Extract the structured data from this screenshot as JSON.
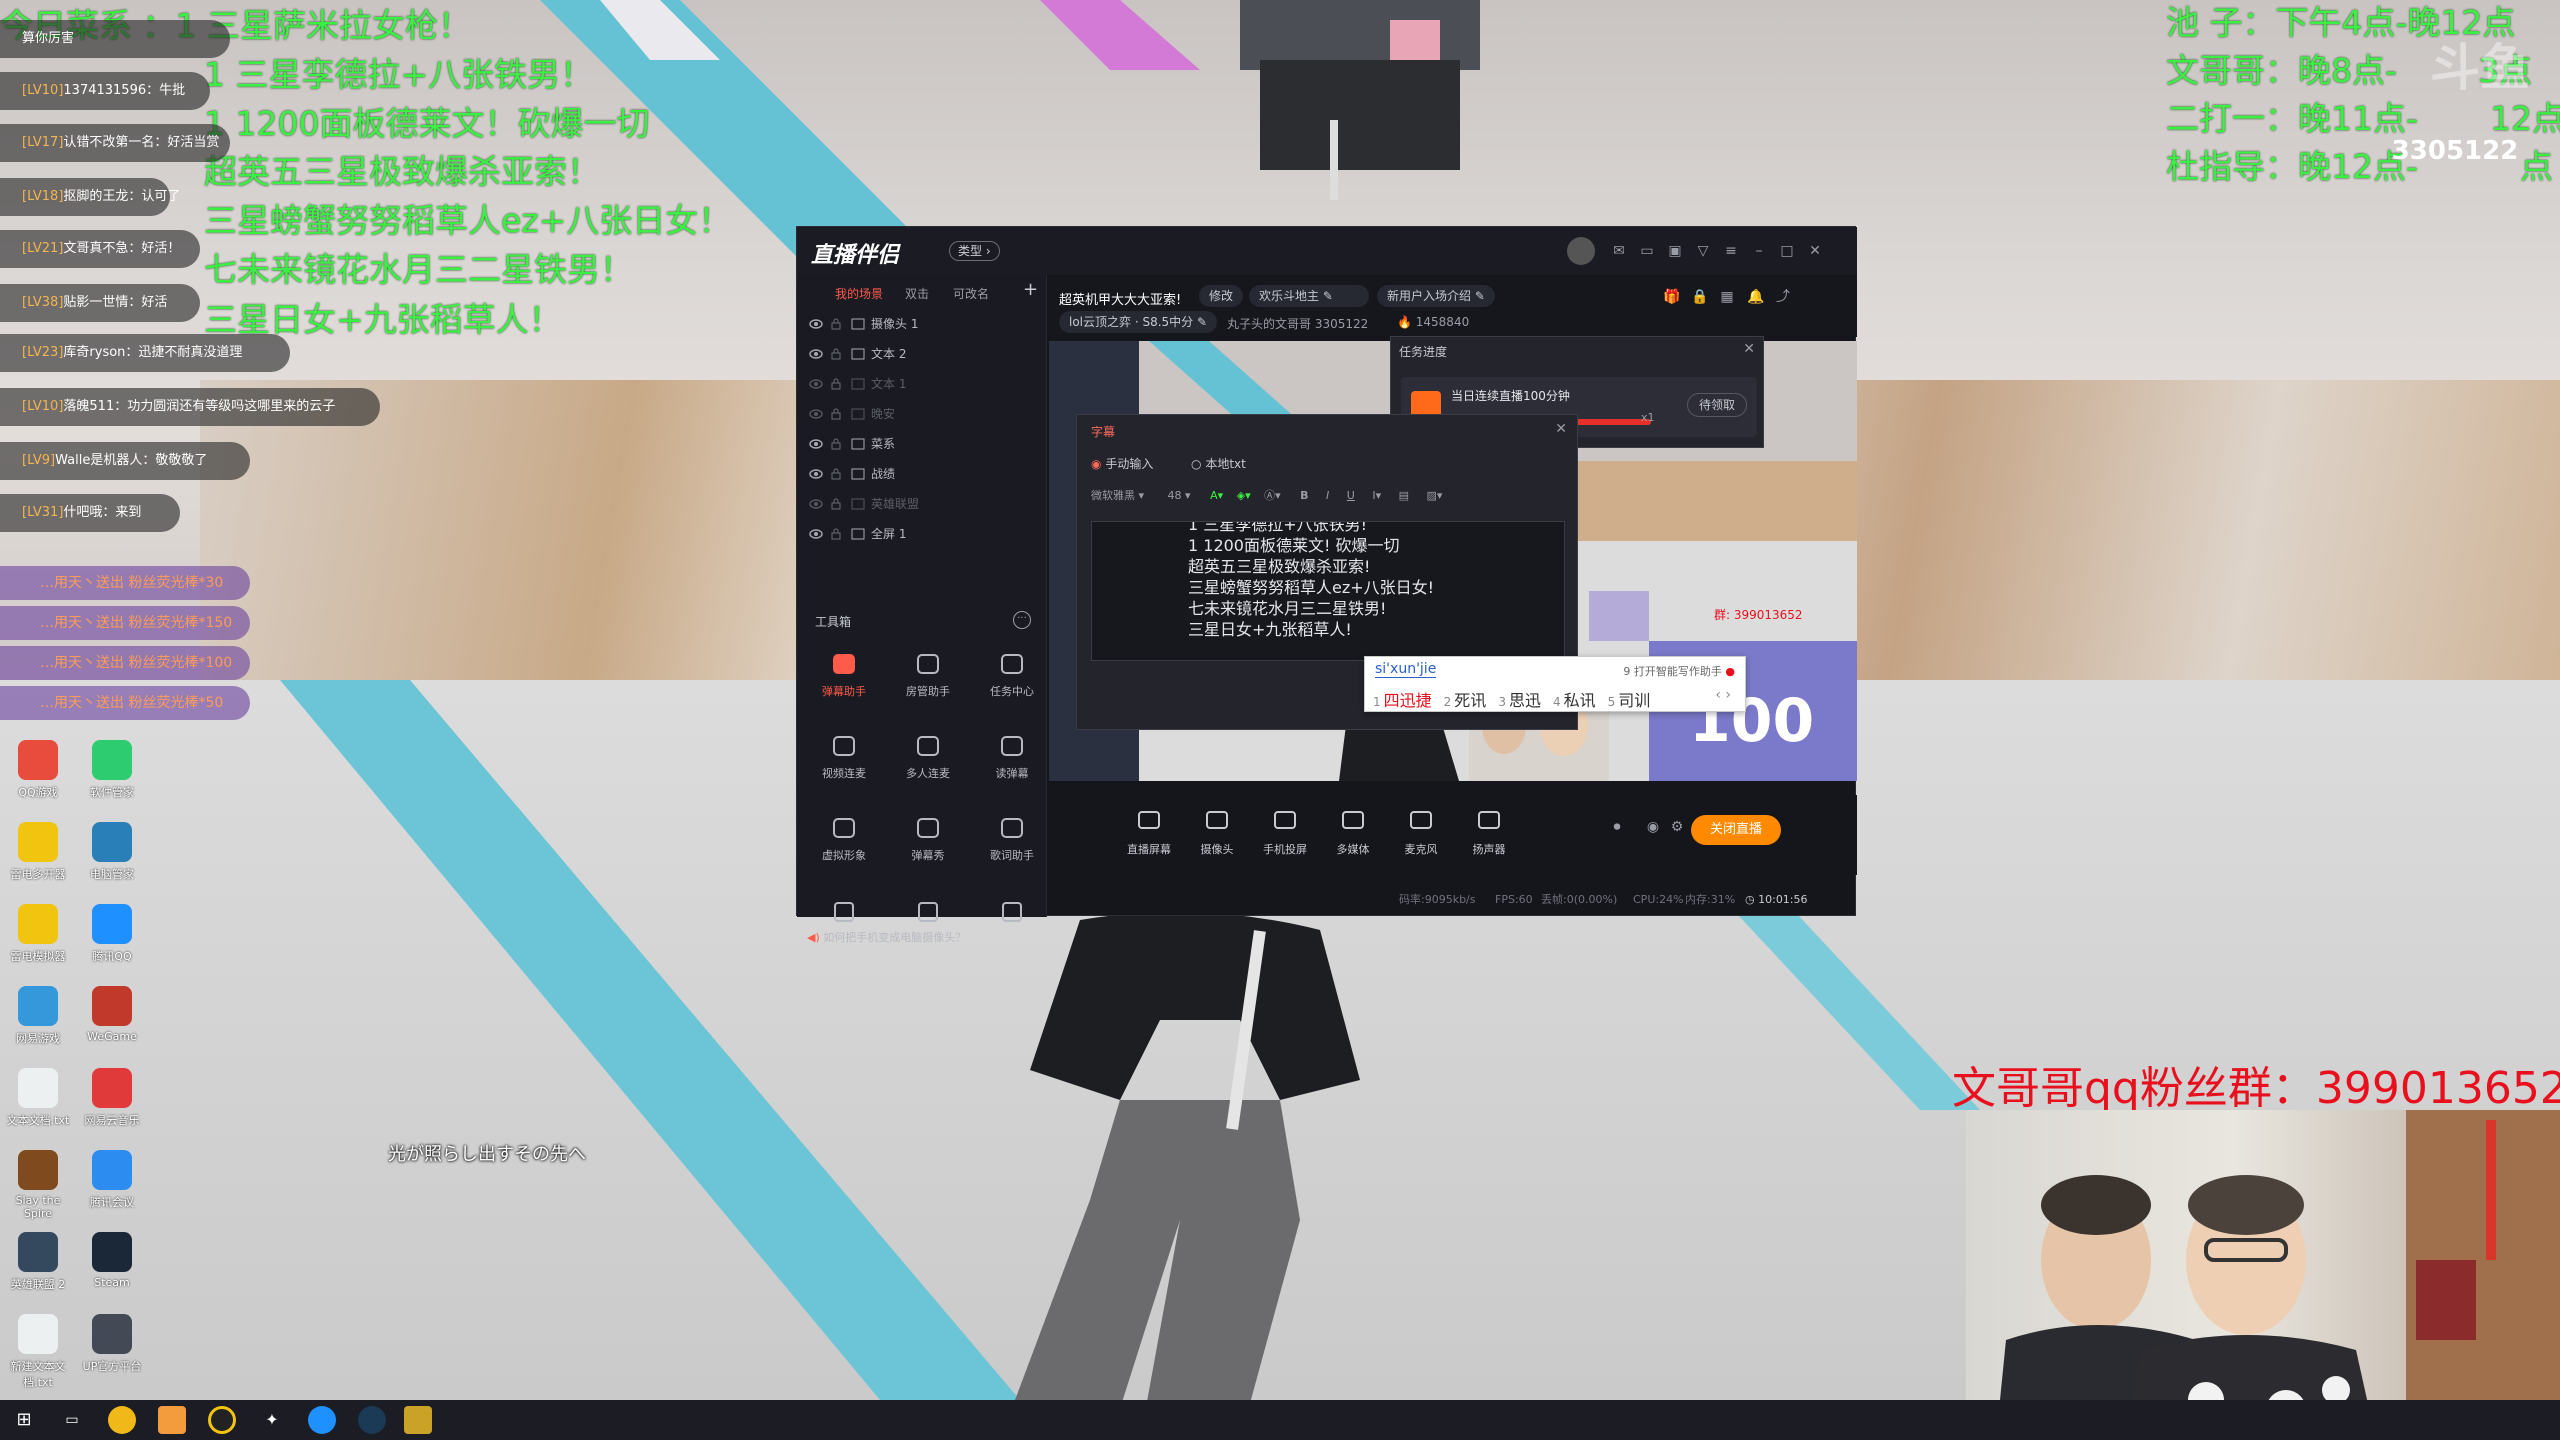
{
  "overlay_left": {
    "lines": [
      "今日菜系 ：1 三星萨米拉女枪！",
      "1 三星孪德拉+八张铁男！",
      "1 1200面板德莱文！砍爆一切",
      "超英五三星极致爆杀亚索！",
      "三星螃蟹努努稻草人ez+八张日女！",
      "七未来镜花水月三二星铁男！",
      "三星日女+九张稻草人！"
    ]
  },
  "overlay_right": {
    "lines": [
      "池 子：下午4点-晚12点",
      "文哥哥：晚8点-",
      "二打一：晚11点-",
      "杜指导：晚12点-"
    ],
    "tail_fragments": [
      "3点",
      "12点",
      "点"
    ]
  },
  "watermark": {
    "text": "3305122"
  },
  "qq_group": {
    "text": "文哥哥qq粉丝群：399013652"
  },
  "lyric": {
    "text": "光が照らし出すその先へ"
  },
  "chat": [
    {
      "level": "",
      "text": "算你厉害"
    },
    {
      "level": "[LV10]",
      "text": "1374131596：牛批"
    },
    {
      "level": "[LV17]",
      "text": "认错不改第一名：好活当赏"
    },
    {
      "level": "[LV18]",
      "text": "抠脚的王龙：认可了"
    },
    {
      "level": "[LV21]",
      "text": "文哥真不急：好活！"
    },
    {
      "level": "[LV38]",
      "text": "贴影一世情：好活"
    },
    {
      "level": "[LV23]",
      "text": "库奇ryson：迅捷不耐真没道理"
    },
    {
      "level": "[LV10]",
      "text": "落魄511：功力圆润还有等级吗这哪里来的云子"
    },
    {
      "level": "[LV9]",
      "text": "Walle是机器人：敬敬敬了"
    },
    {
      "level": "[LV31]",
      "text": "什吧哦：来到"
    }
  ],
  "gifts": [
    {
      "text": "…用天丶送出 粉丝荧光棒*30"
    },
    {
      "text": "…用天丶送出 粉丝荧光棒*150"
    },
    {
      "text": "…用天丶送出 粉丝荧光棒*100"
    },
    {
      "text": "…用天丶送出 粉丝荧光棒*50"
    }
  ],
  "desktop_icons": [
    {
      "label": "QQ游戏",
      "color": "#e74c3c"
    },
    {
      "label": "软件管家",
      "color": "#2ecc71"
    },
    {
      "label": "雷电多开器",
      "color": "#f1c40f"
    },
    {
      "label": "电脑管家",
      "color": "#2980b9"
    },
    {
      "label": "雷电模拟器",
      "color": "#f1c40f"
    },
    {
      "label": "腾讯QQ",
      "color": "#1e90ff"
    },
    {
      "label": "网易游戏",
      "color": "#3498db"
    },
    {
      "label": "WeGame",
      "color": "#c0392b"
    },
    {
      "label": "文本文档.txt",
      "color": "#ecf0f1"
    },
    {
      "label": "网易云音乐",
      "color": "#e03a3a"
    },
    {
      "label": "Slay the Spire",
      "color": "#7f4a1d"
    },
    {
      "label": "腾讯会议",
      "color": "#2d8cf0"
    },
    {
      "label": "英雄联盟 2",
      "color": "#34495e"
    },
    {
      "label": "Steam",
      "color": "#1b2838"
    },
    {
      "label": "新建文本文档.txt",
      "color": "#ecf0f1"
    },
    {
      "label": "UP官方平台",
      "color": "#444a55"
    }
  ],
  "app": {
    "logo": "直播伴侣",
    "badge": "类型",
    "left_tabs": [
      "我的场景",
      "双击",
      "可改名"
    ],
    "scene_items": [
      {
        "name": "摄像头 1",
        "dim": false
      },
      {
        "name": "文本 2",
        "dim": false
      },
      {
        "name": "文本 1",
        "dim": true
      },
      {
        "name": "晚安",
        "dim": true
      },
      {
        "name": "菜系",
        "dim": false
      },
      {
        "name": "战绩",
        "dim": false
      },
      {
        "name": "英雄联盟",
        "dim": true
      },
      {
        "name": "全屏 1",
        "dim": false
      }
    ],
    "tools_header": "工具箱",
    "tools": [
      {
        "label": "弹幕助手",
        "hot": true
      },
      {
        "label": "房管助手",
        "hot": false
      },
      {
        "label": "任务中心",
        "hot": false
      },
      {
        "label": "视频连麦",
        "hot": false
      },
      {
        "label": "多人连麦",
        "hot": false
      },
      {
        "label": "读弹幕",
        "hot": false
      },
      {
        "label": "虚拟形象",
        "hot": false
      },
      {
        "label": "弹幕秀",
        "hot": false
      },
      {
        "label": "歌词助手",
        "hot": false
      }
    ],
    "tip": "如何把手机变成电脑摄像头？",
    "info": {
      "title": "超英机甲大大大亚索!",
      "edit": "修改",
      "category": "欢乐斗地主",
      "intro": "新用户入场介绍",
      "game": "lol云顶之弈 · S8.5中分",
      "anchor": "丸子头的文哥哥 3305122",
      "hot": "1458840"
    },
    "controls": [
      "直播屏幕",
      "摄像头",
      "手机投屏",
      "多媒体",
      "麦克风",
      "扬声器"
    ],
    "go_live": "关闭直播",
    "status": {
      "bitrate": "码率:9095kb/s",
      "fps": "FPS:60",
      "drop": "丢帧:0(0.00%)",
      "cpu": "CPU:24%",
      "mem": "内存:31%",
      "time": "10:01:56"
    }
  },
  "subtitle_dialog": {
    "title": "字幕",
    "radio_manual": "手动输入",
    "radio_local": "本地txt",
    "font": "微软雅黑",
    "size": "48",
    "text_lines": [
      "1 三星孪德拉+八张铁男!",
      "1 1200面板德莱文! 砍爆一切",
      "超英五三星极致爆杀亚索!",
      "三星螃蟹努努稻草人ez+八张日女!",
      "七未来镜花水月三二星铁男!",
      "三星日女+九张稻草人!"
    ]
  },
  "ime": {
    "pinyin": "si'xun'jie",
    "hint": "9 打开智能写作助手",
    "candidates": [
      {
        "n": "1",
        "t": "四迅捷"
      },
      {
        "n": "2",
        "t": "死讯"
      },
      {
        "n": "3",
        "t": "思迅"
      },
      {
        "n": "4",
        "t": "私讯"
      },
      {
        "n": "5",
        "t": "司训"
      }
    ]
  },
  "task_panel": {
    "header": "任务进度",
    "task": "当日连续直播100分钟",
    "multiplier": "x1",
    "button": "待领取",
    "progress": 1.0
  },
  "preview_group": "群: 399013652",
  "colors": {
    "accent": "#ff8a00",
    "green_text": "#3cf043",
    "red_text": "#e8101d"
  }
}
